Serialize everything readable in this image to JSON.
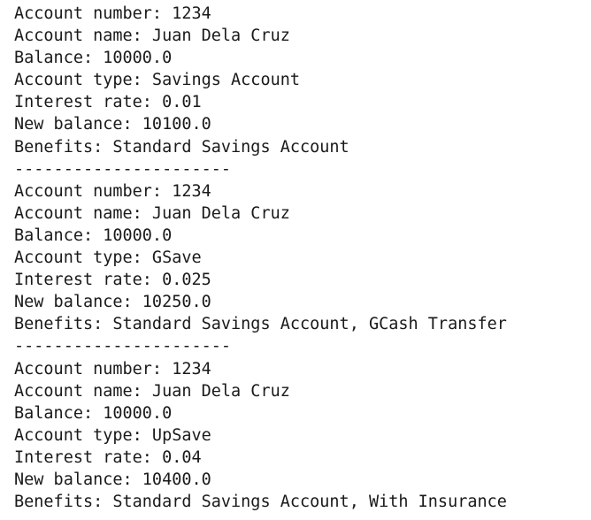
{
  "output": {
    "lines": [
      "Account number: 1234",
      "Account name: Juan Dela Cruz",
      "Balance: 10000.0",
      "Account type: Savings Account",
      "Interest rate: 0.01",
      "New balance: 10100.0",
      "Benefits: Standard Savings Account",
      "----------------------",
      "Account number: 1234",
      "Account name: Juan Dela Cruz",
      "Balance: 10000.0",
      "Account type: GSave",
      "Interest rate: 0.025",
      "New balance: 10250.0",
      "Benefits: Standard Savings Account, GCash Transfer",
      "----------------------",
      "Account number: 1234",
      "Account name: Juan Dela Cruz",
      "Balance: 10000.0",
      "Account type: UpSave",
      "Interest rate: 0.04",
      "New balance: 10400.0",
      "Benefits: Standard Savings Account, With Insurance"
    ]
  }
}
